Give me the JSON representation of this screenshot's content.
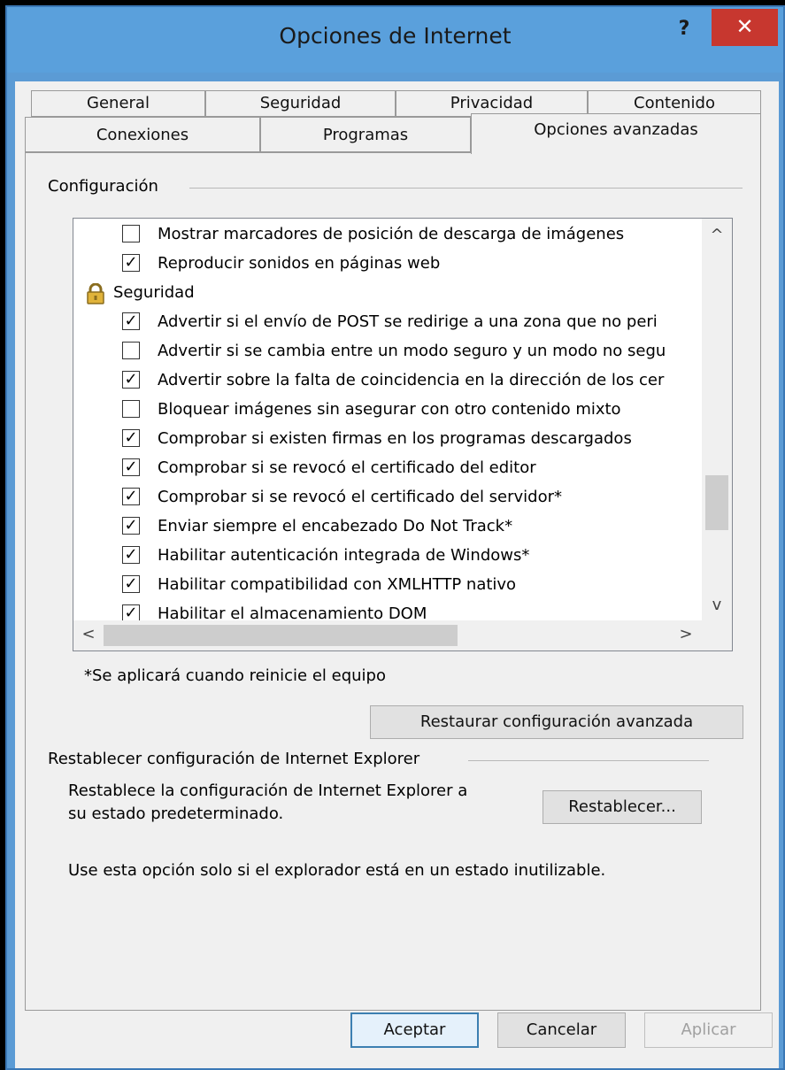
{
  "window": {
    "title": "Opciones de Internet",
    "help_label": "?",
    "close_label": "✕"
  },
  "tabs_row1": [
    "General",
    "Seguridad",
    "Privacidad",
    "Contenido"
  ],
  "tabs_row2": [
    "Conexiones",
    "Programas",
    "Opciones avanzadas"
  ],
  "active_tab": "Opciones avanzadas",
  "config": {
    "group_label": "Configuración",
    "items": [
      {
        "type": "checkbox",
        "checked": false,
        "label": "Mostrar marcadores de posición de descarga de imágenes"
      },
      {
        "type": "checkbox",
        "checked": true,
        "label": "Reproducir sonidos en páginas web"
      },
      {
        "type": "category",
        "icon": "lock-icon",
        "label": "Seguridad"
      },
      {
        "type": "checkbox",
        "checked": true,
        "label": "Advertir si el envío de POST se redirige a una zona que no peri"
      },
      {
        "type": "checkbox",
        "checked": false,
        "label": "Advertir si se cambia entre un modo seguro y un modo no segu"
      },
      {
        "type": "checkbox",
        "checked": true,
        "label": "Advertir sobre la falta de coincidencia en la dirección de los cer"
      },
      {
        "type": "checkbox",
        "checked": false,
        "label": "Bloquear imágenes sin asegurar con otro contenido mixto"
      },
      {
        "type": "checkbox",
        "checked": true,
        "label": "Comprobar si existen firmas en los programas descargados"
      },
      {
        "type": "checkbox",
        "checked": true,
        "label": "Comprobar si se revocó el certificado del editor"
      },
      {
        "type": "checkbox",
        "checked": true,
        "label": "Comprobar si se revocó el certificado del servidor*"
      },
      {
        "type": "checkbox",
        "checked": true,
        "label": "Enviar siempre el encabezado Do Not Track*"
      },
      {
        "type": "checkbox",
        "checked": true,
        "label": "Habilitar autenticación integrada de Windows*"
      },
      {
        "type": "checkbox",
        "checked": true,
        "label": "Habilitar compatibilidad con XMLHTTP nativo"
      },
      {
        "type": "checkbox",
        "checked": true,
        "label": "Habilitar el almacenamiento DOM"
      }
    ],
    "footnote": "*Se aplicará cuando reinicie el equipo",
    "restore_button": "Restaurar configuración avanzada"
  },
  "reset": {
    "group_label": "Restablecer configuración de Internet Explorer",
    "description_line1": "Restablece la configuración de Internet Explorer a",
    "description_line2": "su estado predeterminado.",
    "button": "Restablecer...",
    "warning": "Use esta opción solo si el explorador está en un estado inutilizable."
  },
  "footer": {
    "ok": "Aceptar",
    "cancel": "Cancelar",
    "apply": "Aplicar"
  },
  "scroll": {
    "up": "^",
    "down": "v",
    "left": "<",
    "right": ">"
  }
}
